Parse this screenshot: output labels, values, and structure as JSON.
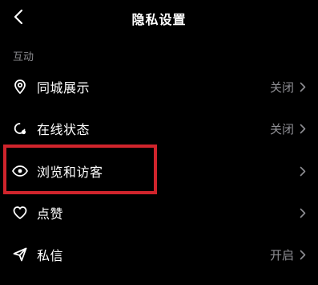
{
  "header": {
    "title": "隐私设置",
    "back_icon": "chevron-left-icon"
  },
  "section": {
    "label": "互动"
  },
  "rows": [
    {
      "label": "同城展示",
      "value": "关闭",
      "icon": "location-pin-icon"
    },
    {
      "label": "在线状态",
      "value": "关闭",
      "icon": "online-status-icon"
    },
    {
      "label": "浏览和访客",
      "value": "",
      "icon": "eye-icon"
    },
    {
      "label": "点赞",
      "value": "",
      "icon": "heart-icon"
    },
    {
      "label": "私信",
      "value": "开启",
      "icon": "send-message-icon"
    }
  ],
  "colors": {
    "background": "#000000",
    "text_primary": "#ffffff",
    "text_secondary": "#8e8e93",
    "highlight": "#d0242c"
  }
}
